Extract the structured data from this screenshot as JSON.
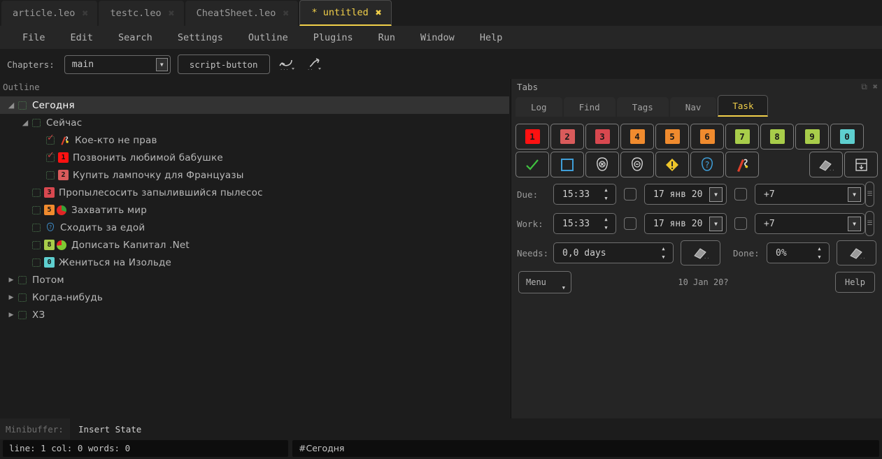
{
  "file_tabs": [
    {
      "label": "article.leo",
      "active": false,
      "close": "✖"
    },
    {
      "label": "testc.leo",
      "active": false,
      "close": "✖"
    },
    {
      "label": "CheatSheet.leo",
      "active": false,
      "close": "✖"
    },
    {
      "label": "* untitled",
      "active": true,
      "close": "✖"
    }
  ],
  "menu": [
    "File",
    "Edit",
    "Search",
    "Settings",
    "Outline",
    "Plugins",
    "Run",
    "Window",
    "Help"
  ],
  "toolbar": {
    "chapters_label": "Chapters:",
    "chapter_value": "main",
    "script_button": "script-button",
    "undo_icon": "undo-arrow-icon",
    "redo_icon": "redo-arrow-icon"
  },
  "outline": {
    "caption": "Outline",
    "rows": [
      {
        "indent": 0,
        "tri": "open",
        "checked": false,
        "text": "Сегодня",
        "selected": true,
        "badge": null,
        "badge_color": null,
        "pie": null,
        "icon": null
      },
      {
        "indent": 1,
        "tri": "open",
        "checked": false,
        "text": "Сейчас",
        "selected": false,
        "badge": null,
        "badge_color": null,
        "pie": null,
        "icon": null
      },
      {
        "indent": 2,
        "tri": "none",
        "checked": true,
        "text": "Кое-кто не прав",
        "selected": false,
        "badge": null,
        "badge_color": null,
        "pie": null,
        "icon": "bomb-icon"
      },
      {
        "indent": 2,
        "tri": "none",
        "checked": true,
        "text": "Позвонить любимой бабушке",
        "selected": false,
        "badge": "1",
        "badge_color": "#ff1111",
        "pie": null,
        "icon": null
      },
      {
        "indent": 2,
        "tri": "none",
        "checked": false,
        "text": "Купить лампочку для Француазы",
        "selected": false,
        "badge": "2",
        "badge_color": "#d95b5b",
        "pie": null,
        "icon": null
      },
      {
        "indent": 1,
        "tri": "none",
        "checked": false,
        "text": "Пропылесосить запылившийся пылесос",
        "selected": false,
        "badge": "3",
        "badge_color": "#d8484f",
        "pie": null,
        "icon": null
      },
      {
        "indent": 1,
        "tri": "none",
        "checked": false,
        "text": "Захватить мир",
        "selected": false,
        "badge": "5",
        "badge_color": "#f08b2e",
        "pie": "red",
        "icon": null
      },
      {
        "indent": 1,
        "tri": "none",
        "checked": false,
        "text": "Сходить за едой",
        "selected": false,
        "badge": null,
        "badge_color": null,
        "pie": null,
        "icon": "question-head-icon"
      },
      {
        "indent": 1,
        "tri": "none",
        "checked": false,
        "text": "Дописать Капитал .Net",
        "selected": false,
        "badge": "8",
        "badge_color": "#a8cd4a",
        "pie": "green",
        "icon": null
      },
      {
        "indent": 1,
        "tri": "none",
        "checked": false,
        "text": "Жениться на Изольде",
        "selected": false,
        "badge": "0",
        "badge_color": "#5ecfcf",
        "pie": null,
        "icon": null
      },
      {
        "indent": 0,
        "tri": "closed",
        "checked": false,
        "text": "Потом",
        "selected": false,
        "badge": null,
        "badge_color": null,
        "pie": null,
        "icon": null
      },
      {
        "indent": 0,
        "tri": "closed",
        "checked": false,
        "text": "Когда-нибудь",
        "selected": false,
        "badge": null,
        "badge_color": null,
        "pie": null,
        "icon": null
      },
      {
        "indent": 0,
        "tri": "closed",
        "checked": false,
        "text": "ХЗ",
        "selected": false,
        "badge": null,
        "badge_color": null,
        "pie": null,
        "icon": null
      }
    ]
  },
  "tabs_panel": {
    "title": "Tabs",
    "restore_icon": "restore-window-icon",
    "close_icon": "close-panel-icon",
    "tabs": [
      {
        "label": "Log",
        "active": false
      },
      {
        "label": "Find",
        "active": false
      },
      {
        "label": "Tags",
        "active": false
      },
      {
        "label": "Nav",
        "active": false
      },
      {
        "label": "Task",
        "active": true
      }
    ],
    "priority_buttons": [
      {
        "label": "1",
        "color": "#ff1111"
      },
      {
        "label": "2",
        "color": "#d95b5b"
      },
      {
        "label": "3",
        "color": "#d8484f"
      },
      {
        "label": "4",
        "color": "#f08b2e"
      },
      {
        "label": "5",
        "color": "#f08b2e"
      },
      {
        "label": "6",
        "color": "#f08b2e"
      },
      {
        "label": "7",
        "color": "#a8cd4a"
      },
      {
        "label": "8",
        "color": "#a8cd4a"
      },
      {
        "label": "9",
        "color": "#a8cd4a"
      },
      {
        "label": "0",
        "color": "#5ecfcf"
      }
    ],
    "state_buttons": [
      "check-icon",
      "square-icon",
      "head-cancel-icon",
      "head-minus-icon",
      "warning-icon",
      "question-head-icon",
      "bomb-icon"
    ],
    "trailing_buttons": [
      "eraser-icon",
      "archive-down-icon"
    ],
    "due": {
      "label": "Due:",
      "time": "15:33",
      "date": "17 янв 20",
      "offset": "+7"
    },
    "work": {
      "label": "Work:",
      "time": "15:33",
      "date": "17 янв 20",
      "offset": "+7"
    },
    "needs": {
      "label": "Needs:",
      "value": "0,0 days",
      "clear_icon": "eraser-icon"
    },
    "done": {
      "label": "Done:",
      "value": "0%",
      "clear_icon": "eraser-icon"
    },
    "footer": {
      "menu": "Menu",
      "date": "10 Jan 20?",
      "help": "Help"
    }
  },
  "minibuffer": {
    "label": "Minibuffer:",
    "value": "Insert State"
  },
  "statusbar": {
    "left": "line: 1 col: 0  words: 0",
    "right": "#Сегодня"
  },
  "colors": {
    "accent": "#f2d04a",
    "panel_bg": "#252525",
    "app_bg": "#1c1c1c"
  }
}
